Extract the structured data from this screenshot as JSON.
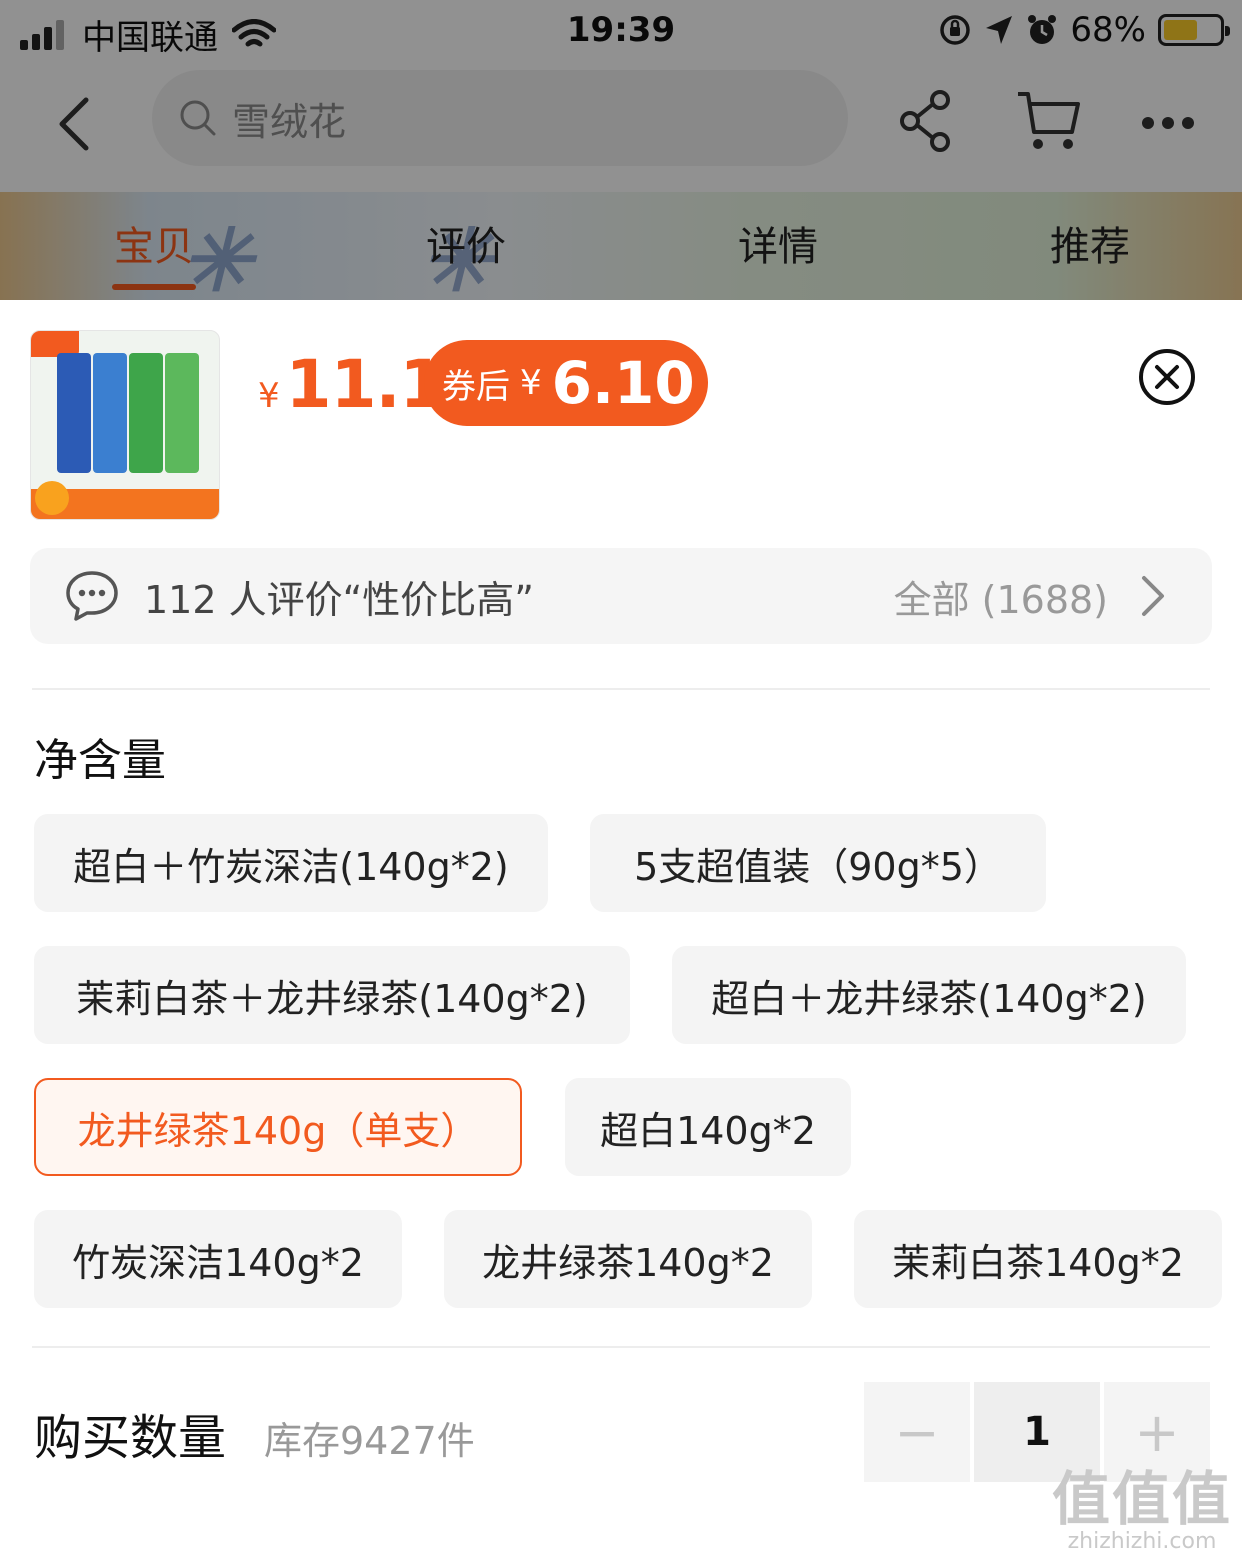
{
  "status_bar": {
    "carrier": "中国联通",
    "time": "19:39",
    "battery": "68%",
    "battery_level": 0.68
  },
  "nav": {
    "search_text": "雪绒花",
    "icons": [
      "back-arrow-icon",
      "search-icon",
      "share-icon",
      "cart-icon",
      "more-icon"
    ]
  },
  "tabs": [
    "宝贝",
    "评价",
    "详情",
    "推荐"
  ],
  "active_tab": "宝贝",
  "product": {
    "price_currency": "¥",
    "price": "11.1",
    "coupon_label": "券后",
    "coupon_currency": "¥",
    "coupon_price": "6.10"
  },
  "review": {
    "summary": "112 人评价“性价比高”",
    "all_label": "全部 (1688)"
  },
  "section": {
    "title": "净含量"
  },
  "options": [
    "超白＋竹炭深洁(140g*2)",
    "5支超值装（90g*5）",
    "茉莉白茶＋龙井绿茶(140g*2)",
    "超白＋龙井绿茶(140g*2)",
    "龙井绿茶140g（单支）",
    "超白140g*2",
    "竹炭深洁140g*2",
    "龙井绿茶140g*2",
    "茉莉白茶140g*2"
  ],
  "selected_option": "龙井绿茶140g（单支）",
  "quantity": {
    "title": "购买数量",
    "stock": "库存9427件",
    "value": "1",
    "minus": "−",
    "plus": "+"
  },
  "watermark": {
    "big": "值值值",
    "small": "zhizhizhi.com"
  },
  "colors": {
    "accent": "#f25a1f",
    "chip_bg": "#f4f4f4",
    "review_bg": "#f5f5f5"
  }
}
